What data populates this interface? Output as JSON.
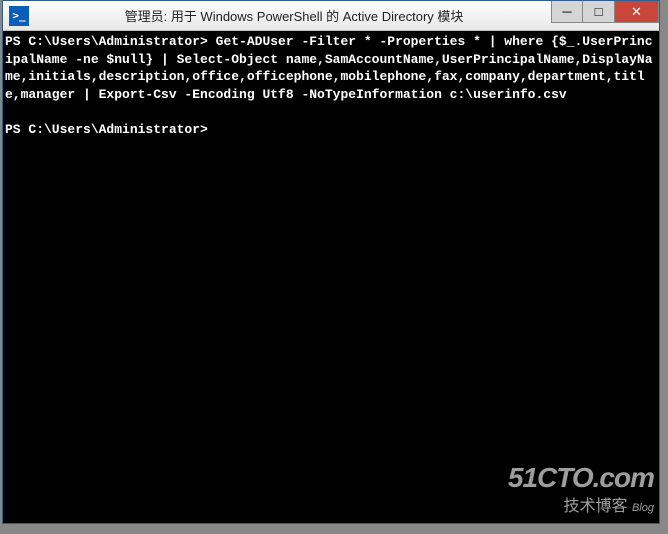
{
  "window": {
    "title": "管理员: 用于 Windows PowerShell 的 Active Directory 模块",
    "icon_glyph": ">_"
  },
  "controls": {
    "minimize": "─",
    "maximize": "□",
    "close": "✕"
  },
  "terminal": {
    "line1_prompt": "PS C:\\Users\\Administrator>",
    "command": " Get-ADUser -Filter * -Properties * | where {$_.UserPrincipalName -ne $null} | Select-Object name,SamAccountName,UserPrincipalName,DisplayName,initials,description,office,officephone,mobilephone,fax,company,department,title,manager | Export-Csv -Encoding Utf8 -NoTypeInformation c:\\userinfo.csv",
    "line2_prompt": "PS C:\\Users\\Administrator> "
  },
  "watermark": {
    "main": "51CTO.com",
    "sub": "技术博客",
    "blog": "Blog"
  }
}
